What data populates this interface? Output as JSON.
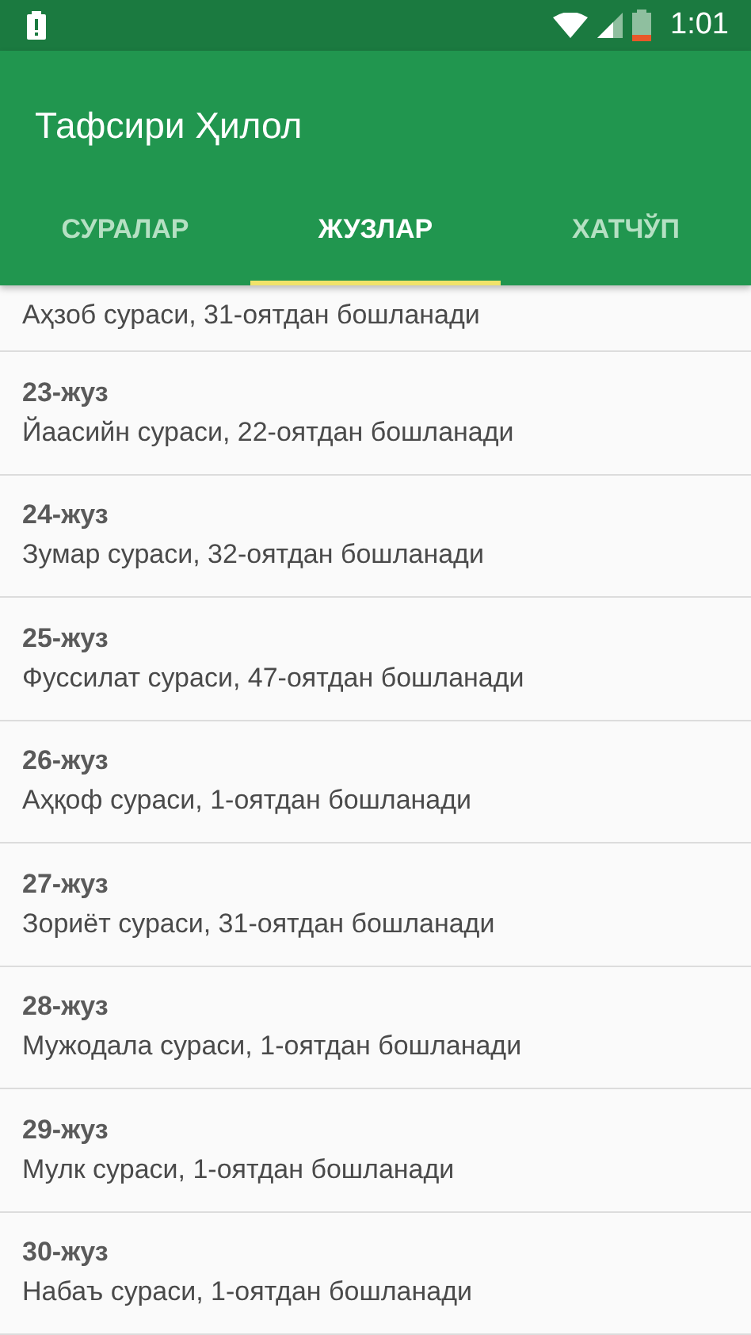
{
  "status_bar": {
    "time": "1:01"
  },
  "app_bar": {
    "title": "Тафсири Ҳилол"
  },
  "tabs": [
    {
      "label": "СУРАЛАР",
      "selected": false
    },
    {
      "label": "ЖУЗЛАР",
      "selected": true
    },
    {
      "label": "ХАТЧЎП",
      "selected": false
    }
  ],
  "list": [
    {
      "subtitle": "Аҳзоб сураси, 31-оятдан бошланади"
    },
    {
      "title": "23-жуз",
      "subtitle": "Йаасийн сураси, 22-оятдан бошланади"
    },
    {
      "title": "24-жуз",
      "subtitle": "Зумар сураси, 32-оятдан бошланади"
    },
    {
      "title": "25-жуз",
      "subtitle": "Фуссилат сураси, 47-оятдан бошланади"
    },
    {
      "title": "26-жуз",
      "subtitle": "Аҳқоф сураси, 1-оятдан бошланади"
    },
    {
      "title": "27-жуз",
      "subtitle": "Зориёт сураси, 31-оятдан бошланади"
    },
    {
      "title": "28-жуз",
      "subtitle": "Мужодала сураси, 1-оятдан бошланади"
    },
    {
      "title": "29-жуз",
      "subtitle": "Мулк сураси, 1-оятдан бошланади"
    },
    {
      "title": "30-жуз",
      "subtitle": "Набаъ сураси, 1-оятдан бошланади"
    }
  ]
}
